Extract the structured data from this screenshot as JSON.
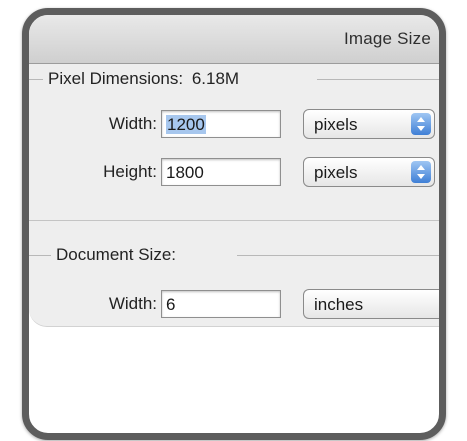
{
  "dialog": {
    "title": "Image Size"
  },
  "pixel_dimensions": {
    "title": "Pixel Dimensions:",
    "size_value": "6.18M",
    "width": {
      "label": "Width:",
      "value": "1200",
      "unit": "pixels"
    },
    "height": {
      "label": "Height:",
      "value": "1800",
      "unit": "pixels"
    }
  },
  "document_size": {
    "title": "Document Size:",
    "width": {
      "label": "Width:",
      "value": "6",
      "unit": "inches"
    }
  },
  "icons": {
    "popup_arrows": "up-down-chevron-icon"
  },
  "colors": {
    "accent": "#3f7fd6",
    "selection": "#a7c7ee"
  }
}
